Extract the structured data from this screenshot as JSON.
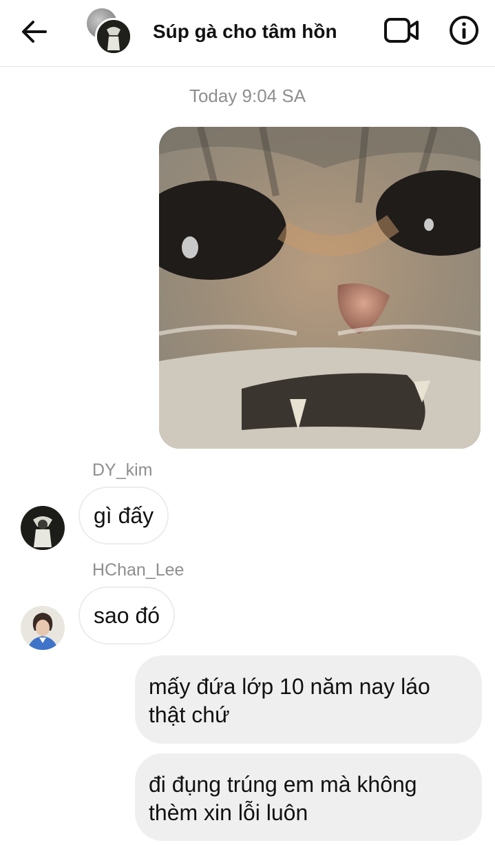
{
  "header": {
    "title": "Súp gà cho tâm hồn",
    "back_icon": "arrow-left-icon",
    "video_icon": "video-call-icon",
    "info_icon": "info-icon"
  },
  "thread": {
    "timestamp": "Today 9:04 SA",
    "messages": [
      {
        "type": "sticker",
        "from": "me",
        "content": "cat-face-sticker"
      },
      {
        "type": "text",
        "from": "DY_kim",
        "sender_label": "DY_kim",
        "text": "gì đấy"
      },
      {
        "type": "text",
        "from": "HChan_Lee",
        "sender_label": "HChan_Lee",
        "text": "sao đó"
      },
      {
        "type": "text",
        "from": "me",
        "text_lines": [
          "mấy đứa lớp 10 năm nay láo",
          "thật chứ"
        ]
      },
      {
        "type": "text",
        "from": "me",
        "text_lines": [
          "đi đụng trúng em mà không",
          "thèm xin lỗi luôn"
        ]
      }
    ]
  },
  "colors": {
    "outgoing_bubble": "#efefef",
    "incoming_border": "#ececec",
    "meta_text": "#8e8e8e"
  }
}
